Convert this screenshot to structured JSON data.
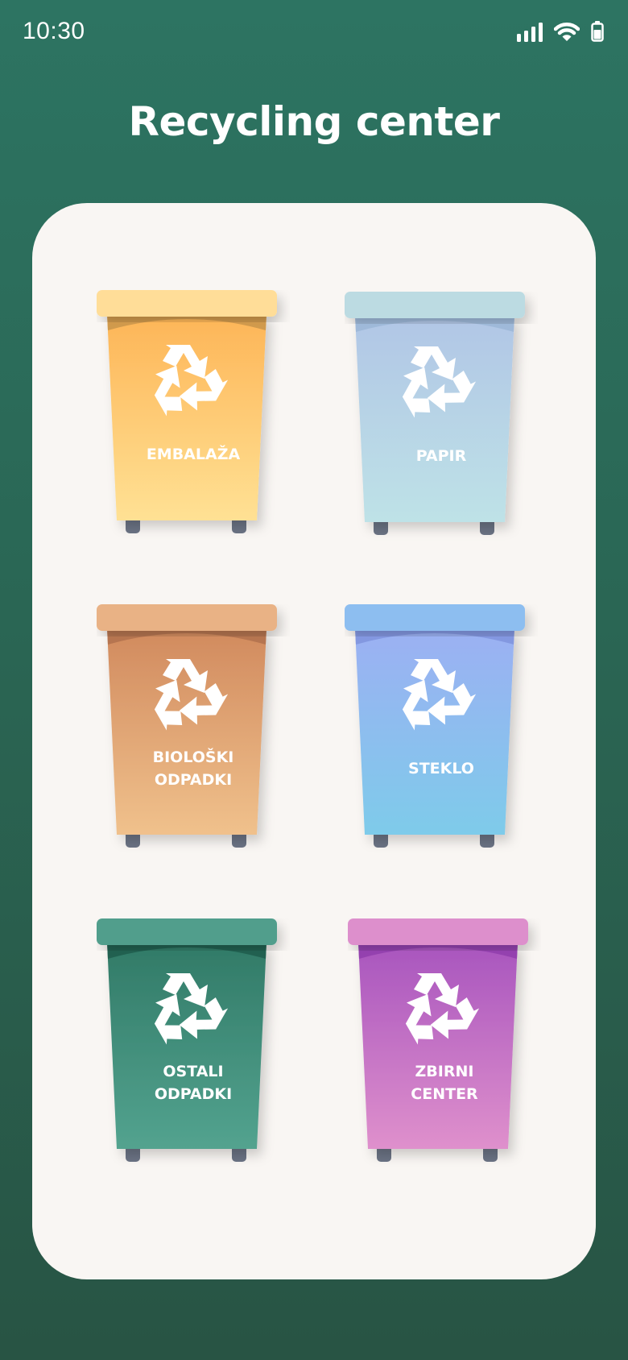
{
  "status": {
    "time": "10:30"
  },
  "header": {
    "title": "Recycling center"
  },
  "bins": [
    {
      "label": "EMBALAŽA",
      "lid": "#ffdd98",
      "top": "#fdb557",
      "bottom": "#ffe194",
      "rim": "#c8944a"
    },
    {
      "label": "PAPIR",
      "lid": "#bcdbe2",
      "top": "#b1c6e6",
      "bottom": "#bee2e7",
      "rim": "#9bb6d6"
    },
    {
      "label": "BIOLOŠKI\nODPADKI",
      "lid": "#e9b285",
      "top": "#d18a5e",
      "bottom": "#f0c18c",
      "rim": "#b0714d"
    },
    {
      "label": "STEKLO",
      "lid": "#8dbef0",
      "top": "#9cb0f3",
      "bottom": "#7ecbea",
      "rim": "#7f93dd"
    },
    {
      "label": "OSTALI\nODPADKI",
      "lid": "#519e8c",
      "top": "#317a67",
      "bottom": "#53a38f",
      "rim": "#1f5c4c"
    },
    {
      "label": "ZBIRNI\nCENTER",
      "lid": "#dd8fcc",
      "top": "#a855be",
      "bottom": "#df90cc",
      "rim": "#8f3dab"
    }
  ]
}
